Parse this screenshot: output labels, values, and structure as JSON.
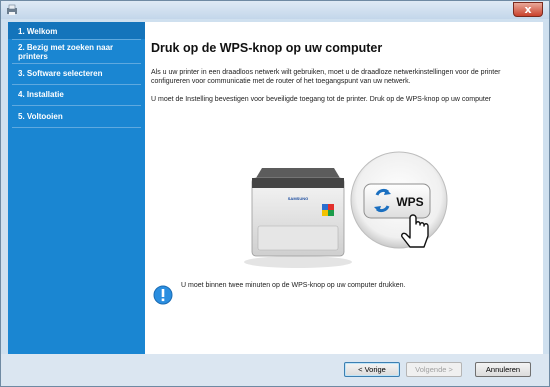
{
  "window": {
    "close_label": "x"
  },
  "sidebar": {
    "steps": [
      {
        "label": "1. Welkom"
      },
      {
        "label": "2. Bezig met zoeken naar printers"
      },
      {
        "label": "3. Software selecteren"
      },
      {
        "label": "4. Installatie"
      },
      {
        "label": "5. Voltooien"
      }
    ],
    "active_index": 0
  },
  "content": {
    "heading": "Druk op de WPS-knop op uw computer",
    "paragraph_1": "Als u uw printer in een draadloos netwerk wilt gebruiken, moet u de draadloze netwerkinstellingen voor de printer configureren voor communicatie met de router of het toegangspunt van uw netwerk.",
    "paragraph_2": "U moet de Instelling bevestigen voor beveiligde toegang tot de printer. Druk op de WPS-knop op uw computer",
    "printer_brand": "SAMSUNG",
    "wps_label": "WPS",
    "note": "U moet binnen twee minuten op de WPS-knop op uw computer drukken."
  },
  "footer": {
    "prev_label": "< Vorige",
    "next_label": "Volgende >",
    "cancel_label": "Annuleren"
  },
  "colors": {
    "sidebar": "#1a86d2",
    "sidebar_active": "#1474bb",
    "wps_blue": "#1a6fc0",
    "info_blue": "#2a8ee0"
  }
}
